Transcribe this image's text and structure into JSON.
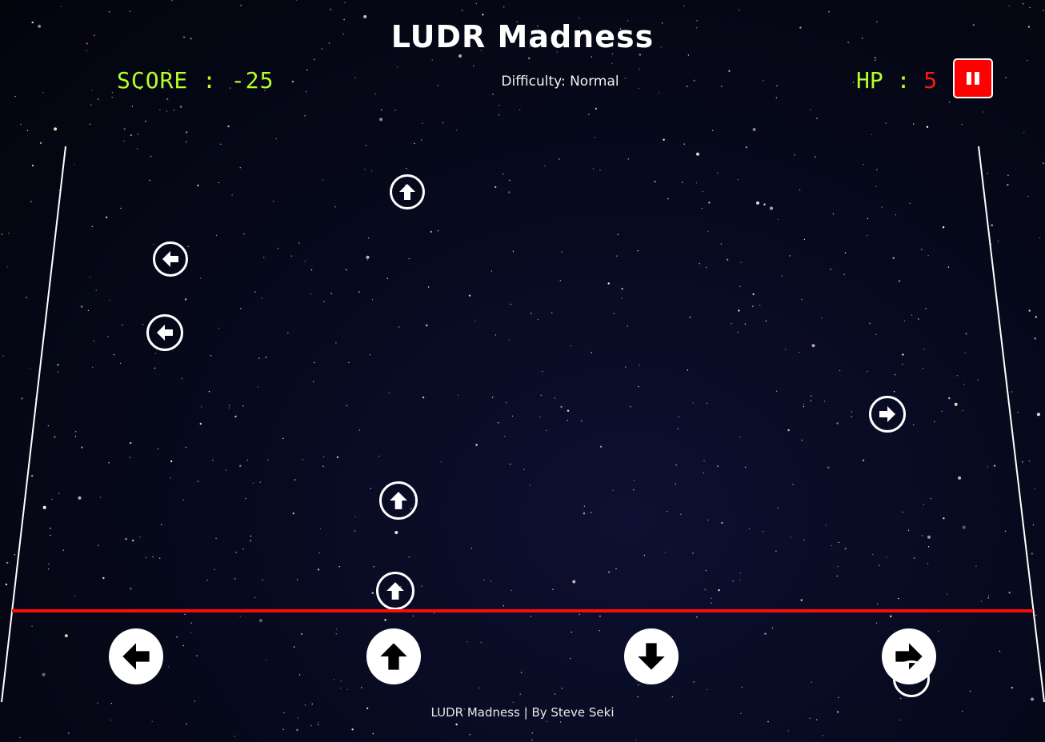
{
  "game": {
    "title": "LUDR Madness",
    "score_label": "SCORE : ",
    "score_value": "-25",
    "difficulty_text": "Difficulty: Normal",
    "hp_label": "HP : ",
    "hp_value": "5",
    "footer": "LUDR Madness | By Steve Seki"
  },
  "pause_button": {
    "icon": "pause-icon"
  },
  "falling_notes": [
    {
      "direction": "up",
      "icon": "arrow-up-icon"
    },
    {
      "direction": "left",
      "icon": "arrow-left-icon"
    },
    {
      "direction": "left",
      "icon": "arrow-left-icon"
    },
    {
      "direction": "right",
      "icon": "arrow-right-icon"
    },
    {
      "direction": "up",
      "icon": "arrow-up-icon"
    },
    {
      "direction": "up",
      "icon": "arrow-up-icon"
    }
  ],
  "key_buttons": [
    {
      "direction": "left",
      "icon": "arrow-left-icon"
    },
    {
      "direction": "up",
      "icon": "arrow-up-icon"
    },
    {
      "direction": "down",
      "icon": "arrow-down-icon"
    },
    {
      "direction": "right",
      "icon": "arrow-right-icon"
    }
  ],
  "colors": {
    "background": "#050816",
    "score": "#b5ff2a",
    "hp_value": "#ff1616",
    "hit_line": "#ff0a0a",
    "pause_button": "#ff0000"
  }
}
